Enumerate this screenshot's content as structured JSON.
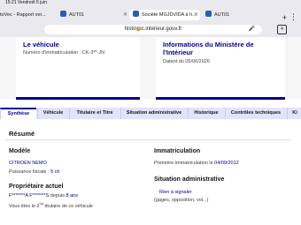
{
  "status_bar": {
    "time_date": "15:21  Vendredi 5 juin"
  },
  "browser": {
    "tabs": [
      {
        "label": "toVec - Rapport ver..."
      },
      {
        "label": "AUT01"
      },
      {
        "label": "Société MGJDVIDA à h..."
      },
      {
        "label": "AUT01"
      }
    ],
    "url": "histovec.interieur.gouv.fr",
    "tab_count": "4"
  },
  "cards": {
    "vehicle": {
      "title": "Le véhicule",
      "plate": "Numéro d'immatriculation : CK-3**-JN"
    },
    "ministry": {
      "title": "Informations du Ministère de l'Intérieur",
      "date": "Datant du 05/06/2026"
    }
  },
  "nav_tabs": [
    "Synthèse",
    "Véhicule",
    "Titulaire et Titre",
    "Situation administrative",
    "Historique",
    "Contrôles techniques",
    "Ki"
  ],
  "summary": {
    "heading": "Résumé",
    "model": {
      "heading": "Modèle",
      "value": "CITROEN NEMO",
      "power_label": "Puissance fiscale :",
      "power_value": "5 ch"
    },
    "owner": {
      "heading": "Propriétaire actuel",
      "name_masked": "F*******A F*******S",
      "since_label": "depuis",
      "since_value": "8 ans",
      "rank_prefix": "Vous êtes le",
      "rank_number": "2",
      "rank_suffix": "nd",
      "rank_tail": "titulaire de ce véhicule"
    },
    "registration": {
      "heading": "Immatriculation",
      "first_label": "Première immatriculation le",
      "first_date": "04/09/2012"
    },
    "admin": {
      "heading": "Situation administrative",
      "value": "Rien à signaler",
      "hint": "(gages, opposition, vol...)"
    }
  },
  "colors": {
    "brand_blue": "#000091",
    "nav_bg": "#e3e3fd"
  }
}
